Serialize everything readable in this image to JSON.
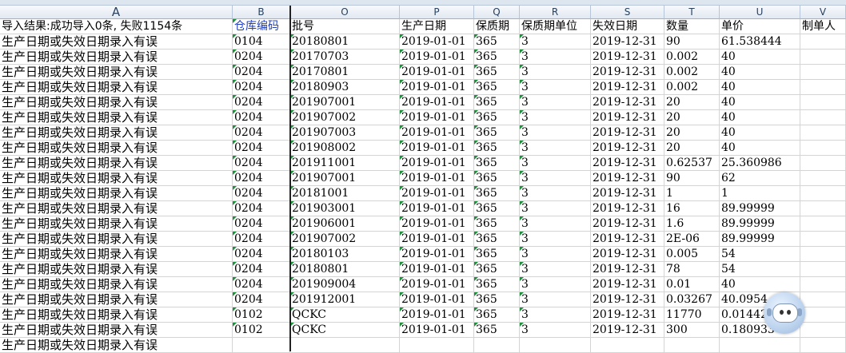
{
  "columns": [
    "A",
    "B",
    "O",
    "P",
    "Q",
    "R",
    "S",
    "T",
    "U",
    "V"
  ],
  "header_row": {
    "a": "导入结果:成功导入0条, 失败1154条",
    "b": "仓库编码",
    "o": "批号",
    "p": "生产日期",
    "q": "保质期",
    "r": "保质期单位",
    "s": "失效日期",
    "t": "数量",
    "u": "单价",
    "v": "制单人"
  },
  "rows": [
    {
      "a": "生产日期或失效日期录入有误",
      "b": "0104",
      "o": "20180801",
      "p": "2019-01-01",
      "q": "365",
      "r": "3",
      "s": "2019-12-31",
      "t": "90",
      "u": "61.538444",
      "v": ""
    },
    {
      "a": "生产日期或失效日期录入有误",
      "b": "0204",
      "o": "20170703",
      "p": "2019-01-01",
      "q": "365",
      "r": "3",
      "s": "2019-12-31",
      "t": "0.002",
      "u": "40",
      "v": ""
    },
    {
      "a": "生产日期或失效日期录入有误",
      "b": "0204",
      "o": "20170801",
      "p": "2019-01-01",
      "q": "365",
      "r": "3",
      "s": "2019-12-31",
      "t": "0.002",
      "u": "40",
      "v": ""
    },
    {
      "a": "生产日期或失效日期录入有误",
      "b": "0204",
      "o": "20180903",
      "p": "2019-01-01",
      "q": "365",
      "r": "3",
      "s": "2019-12-31",
      "t": "0.002",
      "u": "40",
      "v": ""
    },
    {
      "a": "生产日期或失效日期录入有误",
      "b": "0204",
      "o": "201907001",
      "p": "2019-01-01",
      "q": "365",
      "r": "3",
      "s": "2019-12-31",
      "t": "20",
      "u": "40",
      "v": ""
    },
    {
      "a": "生产日期或失效日期录入有误",
      "b": "0204",
      "o": "201907002",
      "p": "2019-01-01",
      "q": "365",
      "r": "3",
      "s": "2019-12-31",
      "t": "20",
      "u": "40",
      "v": ""
    },
    {
      "a": "生产日期或失效日期录入有误",
      "b": "0204",
      "o": "201907003",
      "p": "2019-01-01",
      "q": "365",
      "r": "3",
      "s": "2019-12-31",
      "t": "20",
      "u": "40",
      "v": ""
    },
    {
      "a": "生产日期或失效日期录入有误",
      "b": "0204",
      "o": "201908002",
      "p": "2019-01-01",
      "q": "365",
      "r": "3",
      "s": "2019-12-31",
      "t": "20",
      "u": "40",
      "v": ""
    },
    {
      "a": "生产日期或失效日期录入有误",
      "b": "0204",
      "o": "201911001",
      "p": "2019-01-01",
      "q": "365",
      "r": "3",
      "s": "2019-12-31",
      "t": "0.62537",
      "u": "25.360986",
      "v": ""
    },
    {
      "a": "生产日期或失效日期录入有误",
      "b": "0204",
      "o": "201907001",
      "p": "2019-01-01",
      "q": "365",
      "r": "3",
      "s": "2019-12-31",
      "t": "90",
      "u": "62",
      "v": ""
    },
    {
      "a": "生产日期或失效日期录入有误",
      "b": "0204",
      "o": "20181001",
      "p": "2019-01-01",
      "q": "365",
      "r": "3",
      "s": "2019-12-31",
      "t": "1",
      "u": "1",
      "v": ""
    },
    {
      "a": "生产日期或失效日期录入有误",
      "b": "0204",
      "o": "201903001",
      "p": "2019-01-01",
      "q": "365",
      "r": "3",
      "s": "2019-12-31",
      "t": "16",
      "u": "89.99999",
      "v": ""
    },
    {
      "a": "生产日期或失效日期录入有误",
      "b": "0204",
      "o": "201906001",
      "p": "2019-01-01",
      "q": "365",
      "r": "3",
      "s": "2019-12-31",
      "t": "1.6",
      "u": "89.99999",
      "v": ""
    },
    {
      "a": "生产日期或失效日期录入有误",
      "b": "0204",
      "o": "201907002",
      "p": "2019-01-01",
      "q": "365",
      "r": "3",
      "s": "2019-12-31",
      "t": "2E-06",
      "u": "89.99999",
      "v": ""
    },
    {
      "a": "生产日期或失效日期录入有误",
      "b": "0204",
      "o": "20180103",
      "p": "2019-01-01",
      "q": "365",
      "r": "3",
      "s": "2019-12-31",
      "t": "0.005",
      "u": "54",
      "v": ""
    },
    {
      "a": "生产日期或失效日期录入有误",
      "b": "0204",
      "o": "20180801",
      "p": "2019-01-01",
      "q": "365",
      "r": "3",
      "s": "2019-12-31",
      "t": "78",
      "u": "54",
      "v": ""
    },
    {
      "a": "生产日期或失效日期录入有误",
      "b": "0204",
      "o": "201909004",
      "p": "2019-01-01",
      "q": "365",
      "r": "3",
      "s": "2019-12-31",
      "t": "0.01",
      "u": "40",
      "v": ""
    },
    {
      "a": "生产日期或失效日期录入有误",
      "b": "0204",
      "o": "201912001",
      "p": "2019-01-01",
      "q": "365",
      "r": "3",
      "s": "2019-12-31",
      "t": "0.03267",
      "u": "40.0954",
      "v": ""
    },
    {
      "a": "生产日期或失效日期录入有误",
      "b": "0102",
      "o": "QCKC",
      "p": "2019-01-01",
      "q": "365",
      "r": "3",
      "s": "2019-12-31",
      "t": "11770",
      "u": "0.014422",
      "v": ""
    },
    {
      "a": "生产日期或失效日期录入有误",
      "b": "0102",
      "o": "QCKC",
      "p": "2019-01-01",
      "q": "365",
      "r": "3",
      "s": "2019-12-31",
      "t": "300",
      "u": "0.180933",
      "v": ""
    },
    {
      "a": "生产日期或失效日期录入有误",
      "b": "",
      "o": "",
      "p": "",
      "q": "",
      "r": "",
      "s": "",
      "t": "",
      "u": "",
      "v": ""
    }
  ],
  "colors": {
    "warehouse_header": "#1f3fbf",
    "error_indicator": "#1e8f3a"
  },
  "assistant_icon": "robot-assistant-icon"
}
